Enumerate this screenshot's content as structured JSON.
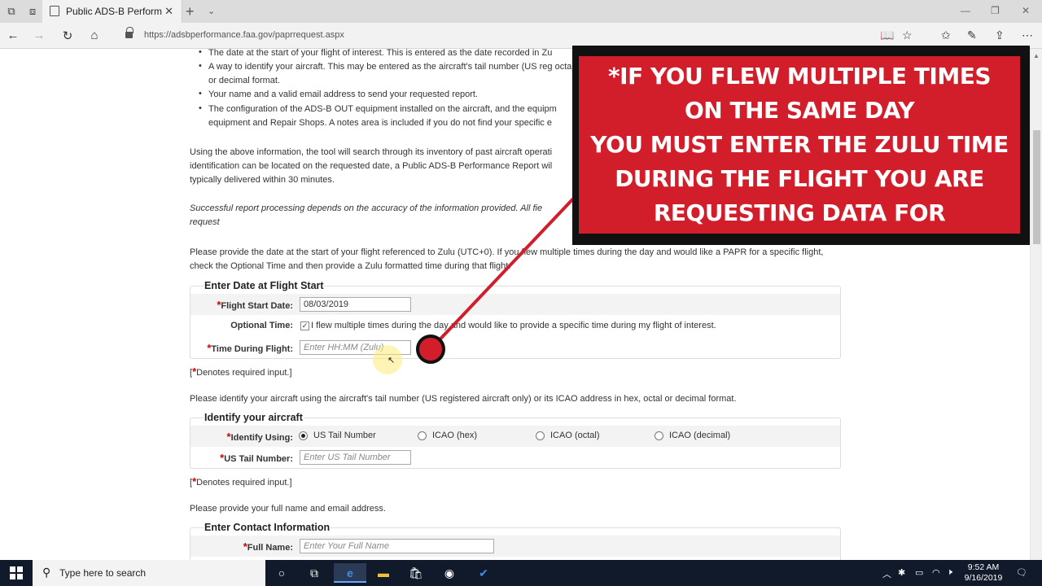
{
  "browser": {
    "tab_title": "Public ADS-B Performar",
    "tab_close": "✕",
    "new_tab": "+",
    "url": "https://adsbperformance.faa.gov/paprrequest.aspx"
  },
  "content": {
    "bullets": [
      {
        "text": "The date at the start of your flight of interest. This is entered as the date recorded in Zu"
      },
      {
        "text": "A way to identify your aircraft. This may be entered as the aircraft's tail number (US reg octal, or decimal format."
      },
      {
        "text": "Your name and a valid email address to send your requested report."
      },
      {
        "text": "The configuration of the ADS-B OUT equipment installed on the aircraft, and the equipm equipment and Repair Shops. A notes area is included if you do not find your specific e"
      }
    ],
    "para_using": "Using the above information, the tool will search through its inventory of past aircraft operati identification can be located on the requested date, a Public ADS-B Performance Report wil typically delivered within 30 minutes.",
    "para_success": "Successful report processing depends on the accuracy of the information provided. All fie request",
    "para_date": "Please provide the date at the start of your flight referenced to Zulu (UTC+0). If you flew multiple times during the day and would like a PAPR for a specific flight, check the Optional Time and then provide a Zulu formatted time during that flight.",
    "date_section": {
      "legend": "Enter Date at Flight Start",
      "start_date_label": "Flight Start Date:",
      "start_date_value": "08/03/2019",
      "optional_time_label": "Optional Time:",
      "optional_time_text": "I flew multiple times during the day and would like to provide a specific time during my flight of interest.",
      "time_label": "Time During Flight:",
      "time_placeholder": "Enter HH:MM (Zulu)"
    },
    "required_note": "Denotes required input.",
    "para_identify": "Please identify your aircraft using the aircraft's tail number (US registered aircraft only) or its ICAO address in hex, octal or decimal format.",
    "identify_section": {
      "legend": "Identify your aircraft",
      "identify_label": "Identify Using:",
      "options": [
        "US Tail Number",
        "ICAO (hex)",
        "ICAO (octal)",
        "ICAO (decimal)"
      ],
      "tail_label": "US Tail Number:",
      "tail_placeholder": "Enter US Tail Number"
    },
    "para_contact": "Please provide your full name and email address.",
    "contact_section": {
      "legend": "Enter Contact Information",
      "name_label": "Full Name:",
      "name_placeholder": "Enter Your Full Name"
    }
  },
  "overlay": {
    "lines": [
      "*IF YOU FLEW MULTIPLE TIMES",
      "ON THE SAME DAY",
      "YOU MUST ENTER THE ZULU TIME",
      "DURING THE FLIGHT YOU ARE",
      "REQUESTING DATA FOR"
    ],
    "color": "#d21e2b"
  },
  "taskbar": {
    "search_placeholder": "Type here to search",
    "time": "9:52 AM",
    "date": "9/16/2019"
  }
}
